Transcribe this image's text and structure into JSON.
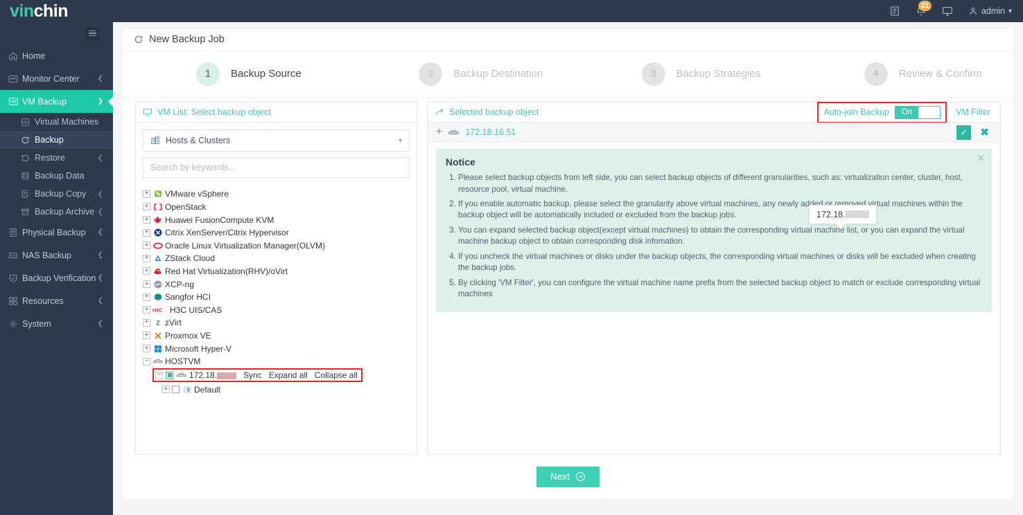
{
  "brand": {
    "name_part1": "vin",
    "name_part2": "chin",
    "accent": "#3fc8b4"
  },
  "topbar": {
    "notifications_count": "21",
    "user": "admin",
    "icons": [
      "document-icon",
      "bell-icon",
      "monitor-icon",
      "user-icon"
    ]
  },
  "sidebar": {
    "items": [
      {
        "label": "Home",
        "icon": "home-icon",
        "expandable": false,
        "active": false
      },
      {
        "label": "Monitor Center",
        "icon": "monitor-center-icon",
        "expandable": true,
        "active": false
      },
      {
        "label": "VM Backup",
        "icon": "vm-icon",
        "expandable": true,
        "active": true
      }
    ],
    "vm_backup_children": [
      {
        "label": "Virtual Machines",
        "icon": "vm-list-icon",
        "expandable": false,
        "selected": false
      },
      {
        "label": "Backup",
        "icon": "backup-icon",
        "expandable": false,
        "selected": true
      },
      {
        "label": "Restore",
        "icon": "restore-icon",
        "expandable": true,
        "selected": false
      },
      {
        "label": "Backup Data",
        "icon": "database-icon",
        "expandable": false,
        "selected": false
      },
      {
        "label": "Backup Copy",
        "icon": "copy-icon",
        "expandable": true,
        "selected": false
      },
      {
        "label": "Backup Archive",
        "icon": "archive-icon",
        "expandable": true,
        "selected": false
      }
    ],
    "items_after": [
      {
        "label": "Physical Backup",
        "icon": "server-icon",
        "expandable": true
      },
      {
        "label": "NAS Backup",
        "icon": "nas-icon",
        "expandable": true
      },
      {
        "label": "Backup Verification",
        "icon": "shield-check-icon",
        "expandable": true
      },
      {
        "label": "Resources",
        "icon": "resources-icon",
        "expandable": true
      },
      {
        "label": "System",
        "icon": "gear-icon",
        "expandable": true
      }
    ]
  },
  "page": {
    "title": "New Backup Job",
    "title_icon": "refresh-icon"
  },
  "stepper": {
    "steps": [
      {
        "num": "1",
        "label": "Backup Source",
        "active": true
      },
      {
        "num": "2",
        "label": "Backup Destination",
        "active": false
      },
      {
        "num": "3",
        "label": "Backup Strategies",
        "active": false
      },
      {
        "num": "4",
        "label": "Review & Confirm",
        "active": false
      }
    ]
  },
  "left_panel": {
    "header": "VM List: Select backup object",
    "header_icon": "monitor-icon",
    "view_selector": {
      "label": "Hosts & Clusters",
      "icon": "cluster-icon"
    },
    "search": {
      "placeholder": "Search by keywords..."
    },
    "tree": [
      {
        "label": "VMware vSphere",
        "icon": "vmware-icon",
        "level": 0,
        "expanded": false
      },
      {
        "label": "OpenStack",
        "icon": "openstack-icon",
        "level": 0,
        "expanded": false
      },
      {
        "label": "Huawei FusionCompute KVM",
        "icon": "huawei-icon",
        "level": 0,
        "expanded": false
      },
      {
        "label": "Citrix XenServer/Citrix Hypervisor",
        "icon": "citrix-icon",
        "level": 0,
        "expanded": false
      },
      {
        "label": "Oracle Linux Virtualization Manager(OLVM)",
        "icon": "oracle-icon",
        "level": 0,
        "expanded": false
      },
      {
        "label": "ZStack Cloud",
        "icon": "zstack-icon",
        "level": 0,
        "expanded": false
      },
      {
        "label": "Red Hat Virtualization(RHV)/oVirt",
        "icon": "redhat-icon",
        "level": 0,
        "expanded": false
      },
      {
        "label": "XCP-ng",
        "icon": "xcpng-icon",
        "level": 0,
        "expanded": false
      },
      {
        "label": "Sangfor HCI",
        "icon": "sangfor-icon",
        "level": 0,
        "expanded": false
      },
      {
        "label": "H3C UIS/CAS",
        "icon": "h3c-icon",
        "level": 0,
        "expanded": false
      },
      {
        "label": "zVirt",
        "icon": "zvirt-icon",
        "level": 0,
        "expanded": false
      },
      {
        "label": "Proxmox VE",
        "icon": "proxmox-icon",
        "level": 0,
        "expanded": false
      },
      {
        "label": "Microsoft Hyper-V",
        "icon": "hyperv-icon",
        "level": 0,
        "expanded": false
      },
      {
        "label": "HOSTVM",
        "icon": "host-icon",
        "level": 0,
        "expanded": true
      }
    ],
    "host_row": {
      "label_prefix": "172.18.",
      "label_redacted": true,
      "actions": [
        "Sync",
        "Expand all",
        "Collapse all"
      ],
      "checkbox_state": "partial",
      "highlighted": true
    },
    "child_row": {
      "label": "Default",
      "icon": "folder-icon",
      "checkbox_state": "unchecked"
    }
  },
  "right_panel": {
    "header": "Selected backup object",
    "header_icon": "arrow-branch-icon",
    "auto_join": {
      "label": "Auto-join Backup",
      "state": "On",
      "highlighted": true
    },
    "vm_filter_label": "VM Filter",
    "selected_object": {
      "name": "172.18.16.51",
      "icon": "host-icon"
    },
    "row_actions": {
      "confirm": "check-icon",
      "cancel": "close-icon"
    },
    "tooltip": {
      "prefix": "172.18.",
      "redacted": true
    }
  },
  "notice": {
    "title": "Notice",
    "items": [
      "Please select backup objects from left side, you can select backup objects of different granularities, such as: virtualization center, cluster, host, resource pool, virtual machine.",
      "If you enable automatic backup, please select the granularity above virtual machines, any newly added or removed virtual machines within the backup object will be automatically included or excluded from the backup jobs.",
      "You can expand selected backup object(except virtual machines) to obtain the corresponding virtual machine list, or you can expand the virtual machine backup object to obtain corresponding disk infomation.",
      "If you uncheck the virtual machines or disks under the backup objects, the corresponding virtual machines or disks will be excluded when creating the backup jobs.",
      "By clicking 'VM Filter', you can configure the virtual machine name prefix from the selected backup object to match or exclude corresponding virtual machines"
    ]
  },
  "footer": {
    "next_label": "Next"
  },
  "colors": {
    "teal": "#3fc8b4",
    "teal_dark": "#2fb8a0",
    "sidebar": "#2e3a4b",
    "highlight_red": "#ed2024",
    "notice_bg": "#ddf1ea"
  }
}
